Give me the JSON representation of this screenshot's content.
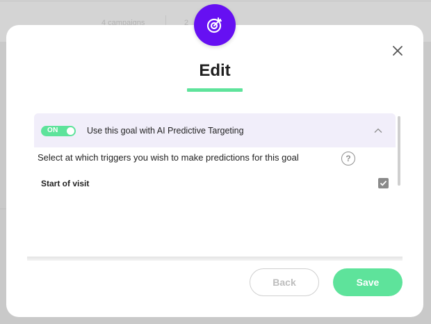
{
  "backdrop": {
    "text1": "4 campaigns",
    "text2": "2"
  },
  "modal": {
    "title": "Edit",
    "badge_icon": "target-icon",
    "close_icon": "close-icon"
  },
  "goal_section": {
    "toggle_label": "ON",
    "toggle_state": "on",
    "title": "Use this goal with AI Predictive Targeting",
    "collapse_icon": "chevron-up-icon",
    "question": "Select at which triggers you wish to make predictions for this goal",
    "help_icon_glyph": "?",
    "triggers": [
      {
        "label": "Start of visit",
        "checked": true
      }
    ]
  },
  "footer": {
    "back_label": "Back",
    "save_label": "Save"
  },
  "colors": {
    "accent_purple": "#6610f2",
    "accent_green": "#5ee39b",
    "section_bg": "#f1eefa"
  }
}
